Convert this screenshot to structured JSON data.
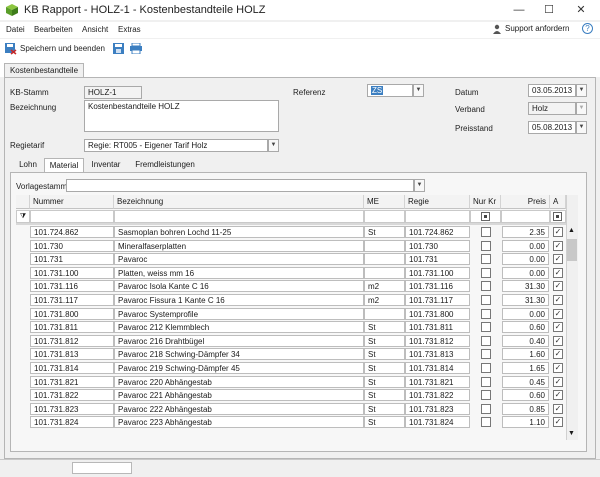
{
  "window": {
    "title": "KB Rapport - HOLZ-1 - Kostenbestandteile HOLZ",
    "minimize": "—",
    "maximize": "☐",
    "close": "✕"
  },
  "menu": {
    "items": [
      "Datei",
      "Bearbeiten",
      "Ansicht",
      "Extras"
    ],
    "support": "Support anfordern",
    "help": "?"
  },
  "toolbar": {
    "save_close": "Speichern und beenden"
  },
  "main_tab": "Kostenbestandteile",
  "form": {
    "kb_stamm_label": "KB-Stamm",
    "kb_stamm_value": "HOLZ-1",
    "bezeichnung_label": "Bezeichnung",
    "bezeichnung_value": "Kostenbestandteile HOLZ",
    "regietarif_label": "Regietarif",
    "regietarif_value": "Regie: RT005 - Eigener Tarif Holz",
    "referenz_label": "Referenz",
    "referenz_value": "ZS",
    "datum_label": "Datum",
    "datum_value": "03.05.2013",
    "verband_label": "Verband",
    "verband_value": "Holz",
    "preisstand_label": "Preisstand",
    "preisstand_value": "05.08.2013"
  },
  "subtabs": [
    "Lohn",
    "Material",
    "Inventar",
    "Fremdleistungen"
  ],
  "vorlagestamm_label": "Vorlagestamm",
  "grid": {
    "headers": {
      "nummer": "Nummer",
      "bezeichnung": "Bezeichnung",
      "me": "ME",
      "regie": "Regie",
      "nur_kr": "Nur Kr",
      "preis": "Preis",
      "a": "A"
    },
    "rows": [
      [
        "101.724.862",
        "Sasmoplan bohren Lochd 11-25",
        "St",
        "101.724.862",
        "2.35"
      ],
      [
        "101.730",
        "Mineralfaserplatten",
        "",
        "101.730",
        "0.00"
      ],
      [
        "101.731",
        "Pavaroc",
        "",
        "101.731",
        "0.00"
      ],
      [
        "101.731.100",
        "Platten, weiss mm 16",
        "",
        "101.731.100",
        "0.00"
      ],
      [
        "101.731.116",
        "Pavaroc Isola Kante C 16",
        "m2",
        "101.731.116",
        "31.30"
      ],
      [
        "101.731.117",
        "Pavaroc Fissura 1 Kante C 16",
        "m2",
        "101.731.117",
        "31.30"
      ],
      [
        "101.731.800",
        "Pavaroc Systemprofile",
        "",
        "101.731.800",
        "0.00"
      ],
      [
        "101.731.811",
        "Pavaroc 212 Klemmblech",
        "St",
        "101.731.811",
        "0.60"
      ],
      [
        "101.731.812",
        "Pavaroc 216 Drahtbügel",
        "St",
        "101.731.812",
        "0.40"
      ],
      [
        "101.731.813",
        "Pavaroc 218 Schwing-Dämpfer 34",
        "St",
        "101.731.813",
        "1.60"
      ],
      [
        "101.731.814",
        "Pavaroc 219 Schwing-Dämpfer 45",
        "St",
        "101.731.814",
        "1.65"
      ],
      [
        "101.731.821",
        "Pavaroc 220 Abhängestab",
        "St",
        "101.731.821",
        "0.45"
      ],
      [
        "101.731.822",
        "Pavaroc 221 Abhängestab",
        "St",
        "101.731.822",
        "0.60"
      ],
      [
        "101.731.823",
        "Pavaroc 222 Abhängestab",
        "St",
        "101.731.823",
        "0.85"
      ],
      [
        "101.731.824",
        "Pavaroc 223 Abhängestab",
        "St",
        "101.731.824",
        "1.10"
      ]
    ]
  },
  "colors": {
    "accent": "#3c7fc1",
    "panel": "#f0f0f0"
  }
}
